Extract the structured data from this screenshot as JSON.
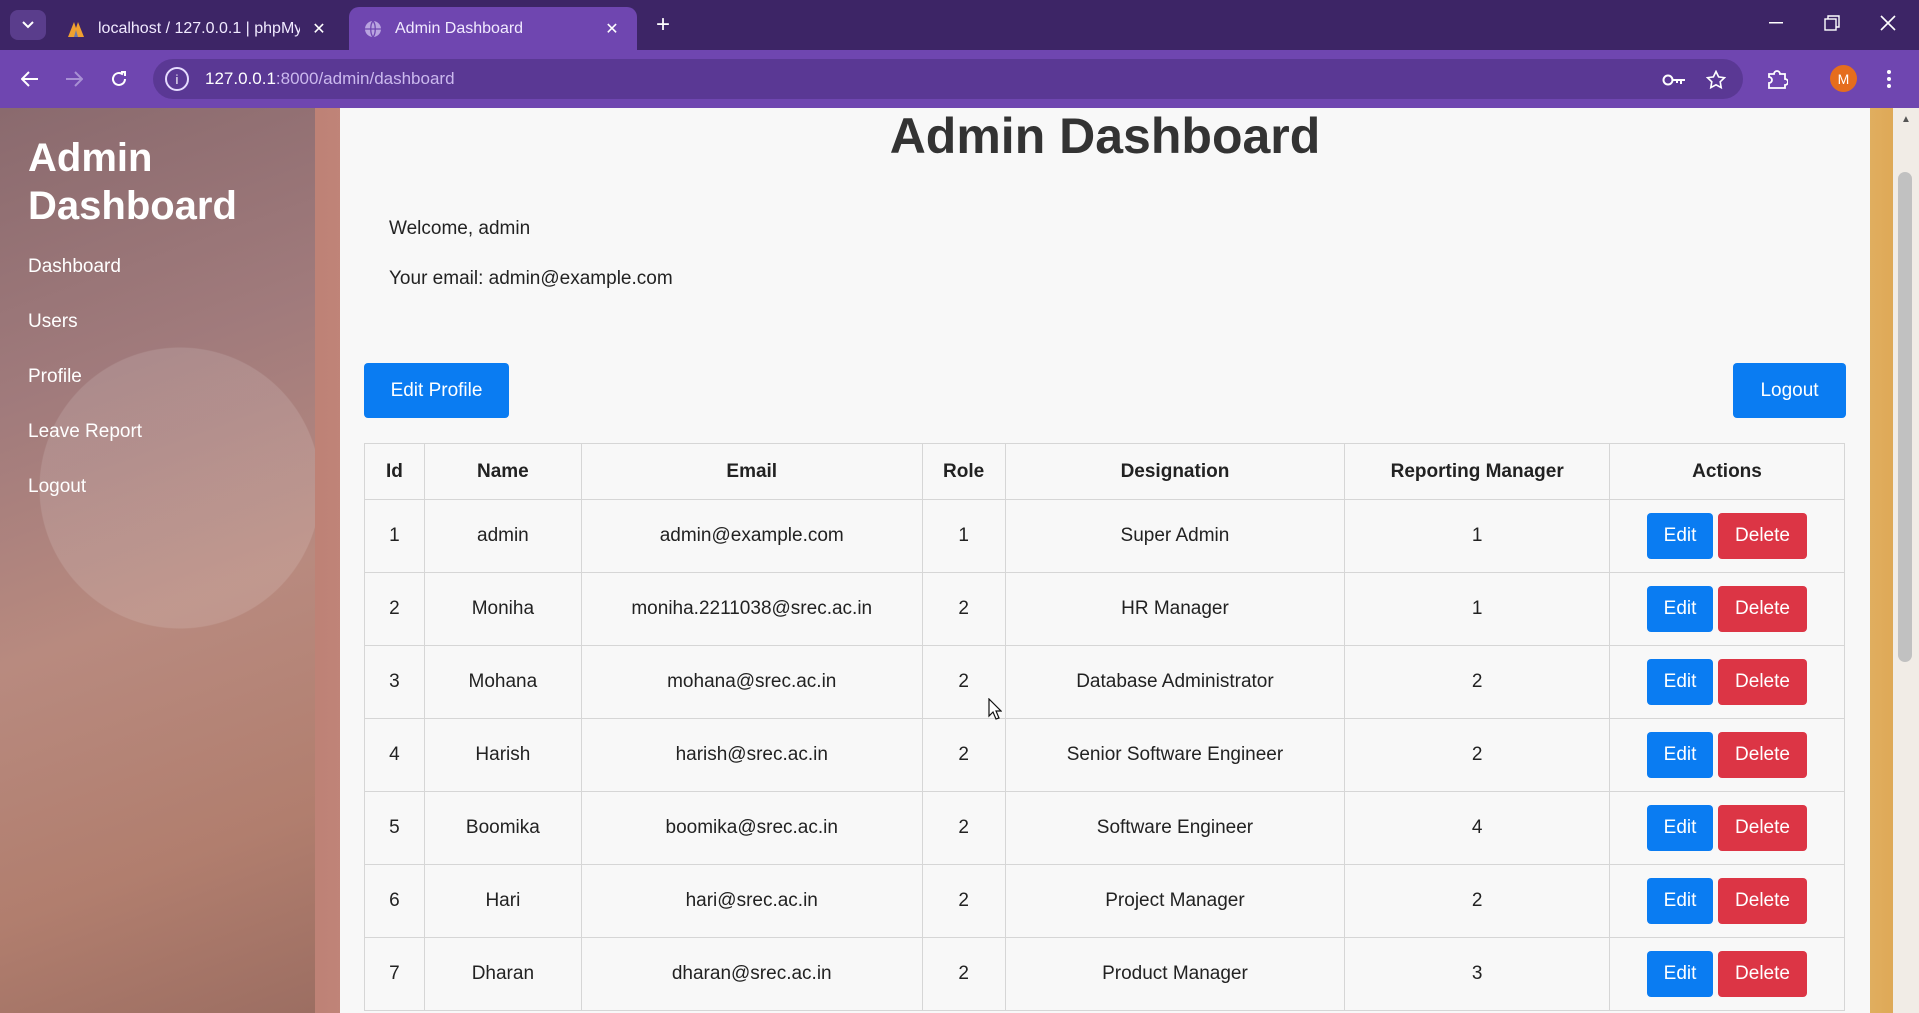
{
  "browser": {
    "tabs": [
      {
        "title": "localhost / 127.0.0.1 | phpMyAdmin",
        "icon": "phpmyadmin-icon",
        "active": false
      },
      {
        "title": "Admin Dashboard",
        "icon": "globe-icon",
        "active": true
      }
    ],
    "url_host": "127.0.0.1",
    "url_rest": ":8000/admin/dashboard",
    "profile_initial": "M"
  },
  "sidebar": {
    "brand": "Admin Dashboard",
    "items": [
      "Dashboard",
      "Users",
      "Profile",
      "Leave Report",
      "Logout"
    ]
  },
  "main": {
    "title": "Admin Dashboard",
    "welcome": "Welcome, admin",
    "email_line": "Your email: admin@example.com",
    "edit_profile_label": "Edit Profile",
    "logout_label": "Logout"
  },
  "table": {
    "headers": [
      "Id",
      "Name",
      "Email",
      "Role",
      "Designation",
      "Reporting Manager",
      "Actions"
    ],
    "rows": [
      [
        "1",
        "admin",
        "admin@example.com",
        "1",
        "Super Admin",
        "1"
      ],
      [
        "2",
        "Moniha",
        "moniha.2211038@srec.ac.in",
        "2",
        "HR Manager",
        "1"
      ],
      [
        "3",
        "Mohana",
        "mohana@srec.ac.in",
        "2",
        "Database Administrator",
        "2"
      ],
      [
        "4",
        "Harish",
        "harish@srec.ac.in",
        "2",
        "Senior Software Engineer",
        "2"
      ],
      [
        "5",
        "Boomika",
        "boomika@srec.ac.in",
        "2",
        "Software Engineer",
        "4"
      ],
      [
        "6",
        "Hari",
        "hari@srec.ac.in",
        "2",
        "Project Manager",
        "2"
      ],
      [
        "7",
        "Dharan",
        "dharan@srec.ac.in",
        "2",
        "Product Manager",
        "3"
      ]
    ],
    "edit_label": "Edit",
    "delete_label": "Delete"
  },
  "colors": {
    "primary": "#0a7cf2",
    "danger": "#dc3545",
    "chrome": "#6f46b0"
  }
}
